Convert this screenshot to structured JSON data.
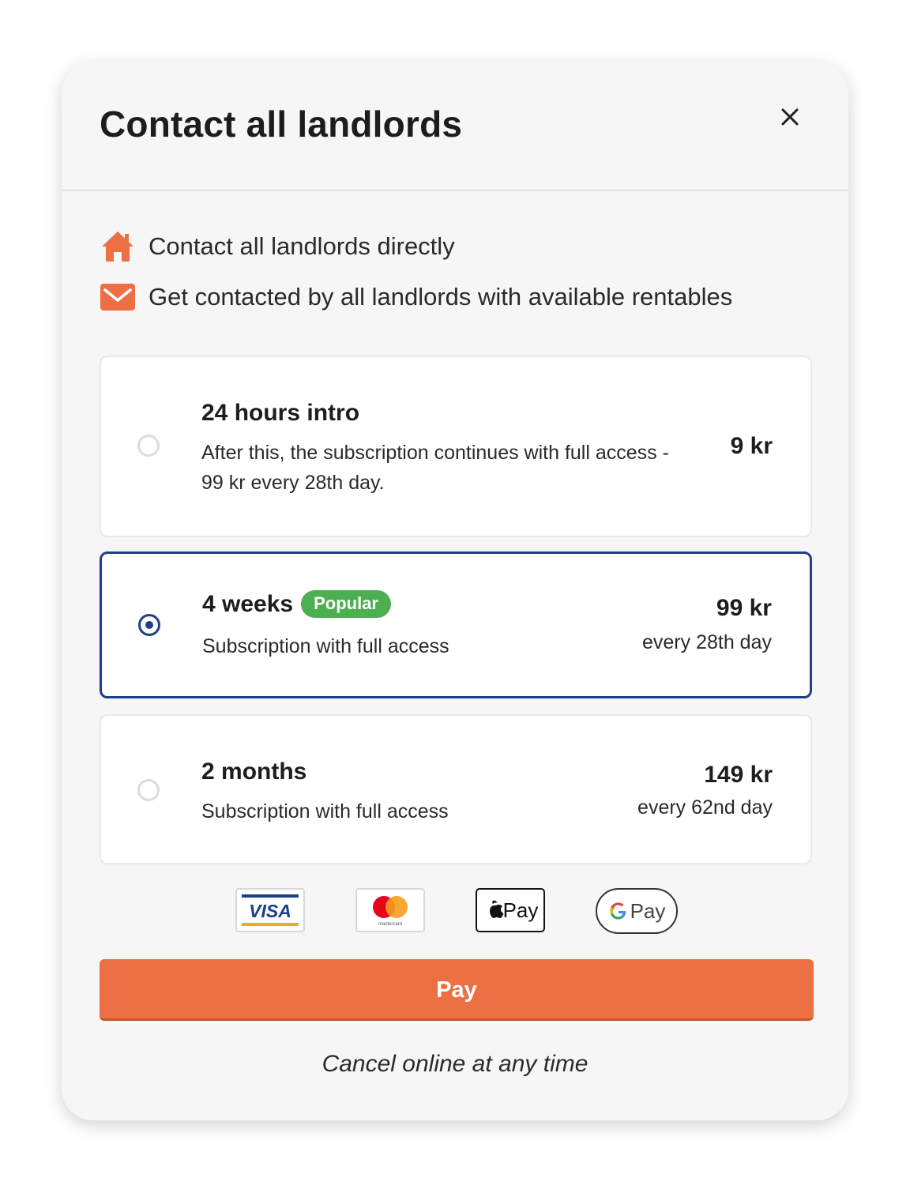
{
  "modal": {
    "title": "Contact all landlords",
    "close_icon": "close-icon"
  },
  "features": [
    {
      "icon": "house-icon",
      "text": "Contact all landlords directly"
    },
    {
      "icon": "envelope-icon",
      "text": "Get contacted by all landlords with available rentables"
    }
  ],
  "plans": [
    {
      "name": "24 hours intro",
      "description": "After this, the subscription continues with full access - 99 kr every 28th day.",
      "price": "9 kr",
      "selected": false
    },
    {
      "name": "4 weeks",
      "badge": "Popular",
      "description": "Subscription with full access",
      "price": "99 kr",
      "period": "every 28th day",
      "selected": true
    },
    {
      "name": "2 months",
      "description": "Subscription with full access",
      "price": "149 kr",
      "period": "every 62nd day",
      "selected": false
    }
  ],
  "payment_methods": [
    {
      "icon": "visa-logo",
      "label": "VISA"
    },
    {
      "icon": "mastercard-logo",
      "label": "mastercard"
    },
    {
      "icon": "apple-pay-logo",
      "label": "Pay"
    },
    {
      "icon": "google-pay-logo",
      "label": "Pay"
    }
  ],
  "pay_button": {
    "label": "Pay"
  },
  "footnote": "Cancel online at any time",
  "colors": {
    "accent": "#ec7043",
    "selected_border": "#1f3f8a",
    "badge": "#4caf50",
    "modal_bg": "#f6f6f6"
  }
}
